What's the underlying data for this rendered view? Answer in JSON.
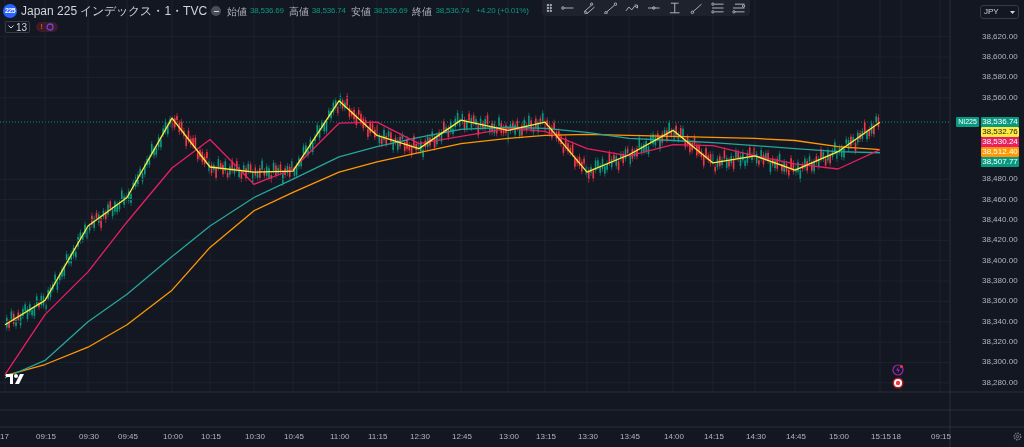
{
  "symbol": {
    "logo_text": "225",
    "title": "Japan 225 インデックス・1・TVC"
  },
  "ohlc": [
    {
      "label": "始値",
      "value": "38,536.69"
    },
    {
      "label": "高値",
      "value": "38,536.74"
    },
    {
      "label": "安値",
      "value": "38,536.69"
    },
    {
      "label": "終値",
      "value": "38,536.74"
    }
  ],
  "change": "+4.20 (+0.01%)",
  "indicators_count": "13",
  "alert_badge": "!",
  "currency": "JPY",
  "chart_data": {
    "type": "line",
    "grid": true,
    "ylim": [
      38271,
      38656
    ],
    "x": [
      "17",
      "09:15",
      "09:30",
      "09:45",
      "10:00",
      "10:15",
      "10:30",
      "10:45",
      "11:00",
      "11:15",
      "12:30",
      "12:45",
      "13:00",
      "13:15",
      "13:30",
      "13:45",
      "14:00",
      "14:15",
      "14:30",
      "14:45",
      "15:00",
      "15:15",
      "18",
      "09:15"
    ],
    "series": [
      {
        "color": "#ffeb3b",
        "values": [
          38337,
          38361,
          38434,
          38462,
          38540,
          38492,
          38487,
          38488,
          38557,
          38523,
          38510,
          38538,
          38528,
          38536,
          38487,
          38504,
          38528,
          38496,
          38503,
          38489,
          38507,
          38536,
          null,
          null
        ]
      },
      {
        "color": "#e91e63",
        "values": [
          38288,
          38347,
          38389,
          38438,
          38491,
          38519,
          38475,
          38490,
          38535,
          38536,
          38515,
          38522,
          38530,
          38527,
          38510,
          38503,
          38514,
          38513,
          38503,
          38495,
          38490,
          38509,
          null,
          null
        ]
      },
      {
        "color": "#26a69a",
        "values": [
          38285,
          38302,
          38340,
          38367,
          38404,
          38434,
          38462,
          38480,
          38502,
          38512,
          38521,
          38529,
          38531,
          38530,
          38526,
          38520,
          38518,
          38516,
          38513,
          38510,
          38507,
          38506,
          null,
          null
        ]
      },
      {
        "color": "#ff9800",
        "values": [
          38287,
          38298,
          38315,
          38337,
          38371,
          38413,
          38449,
          38467,
          38487,
          38497,
          38506,
          38515,
          38520,
          38523,
          38524,
          38523,
          38522,
          38521,
          38520,
          38518,
          38512,
          38509,
          null,
          null
        ]
      }
    ],
    "yticks": [
      {
        "value": 38620,
        "label": "38,620.00"
      },
      {
        "value": 38600,
        "label": "38,600.00"
      },
      {
        "value": 38580,
        "label": "38,580.00"
      },
      {
        "value": 38560,
        "label": "38,560.00"
      },
      {
        "value": 38480,
        "label": "38,480.00"
      },
      {
        "value": 38460,
        "label": "38,460.00"
      },
      {
        "value": 38440,
        "label": "38,440.00"
      },
      {
        "value": 38420,
        "label": "38,420.00"
      },
      {
        "value": 38400,
        "label": "38,400.00"
      },
      {
        "value": 38380,
        "label": "38,380.00"
      },
      {
        "value": 38360,
        "label": "38,360.00"
      },
      {
        "value": 38340,
        "label": "38,340.00"
      },
      {
        "value": 38320,
        "label": "38,320.00"
      },
      {
        "value": 38300,
        "label": "38,300.00"
      },
      {
        "value": 38280,
        "label": "38,280.00"
      }
    ]
  },
  "price_tags": [
    {
      "label": "NI225",
      "value": "38,536.74",
      "color": "#089981"
    },
    {
      "value": "38,532.76",
      "color": "#ffeb3b"
    },
    {
      "value": "38,530.24",
      "color": "#e91e63"
    },
    {
      "value": "38,512.40",
      "color": "#ff9800"
    },
    {
      "value": "38,507.77",
      "color": "#089981"
    }
  ]
}
